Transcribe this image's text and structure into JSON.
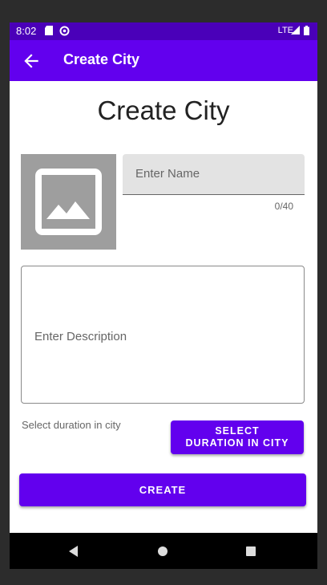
{
  "status_bar": {
    "time": "8:02",
    "network_label": "LTE",
    "icons": [
      "sd-card-icon",
      "vpn-icon",
      "signal-icon",
      "battery-icon"
    ]
  },
  "app_bar": {
    "title": "Create City",
    "back_icon": "arrow-back-icon"
  },
  "form": {
    "heading": "Create City",
    "image_placeholder_icon": "image-placeholder-icon",
    "name_field": {
      "value": "",
      "placeholder": "Enter Name",
      "counter": "0/40"
    },
    "description_field": {
      "value": "",
      "placeholder": "Enter Description"
    },
    "duration_label": "Select duration in city",
    "select_duration_button": "SELECT DURATION IN CITY",
    "create_button": "CREATE"
  },
  "nav_bar": {
    "icons": [
      "nav-back-icon",
      "nav-home-icon",
      "nav-recents-icon"
    ]
  },
  "colors": {
    "primary": "#6200ee",
    "status_bar": "#4a00b9",
    "field_background": "#e3e3e3",
    "placeholder_image": "#9e9e9e"
  }
}
